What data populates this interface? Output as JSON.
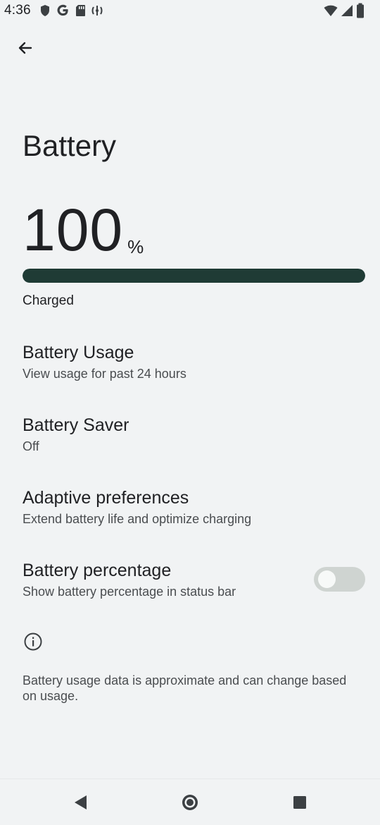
{
  "status_bar": {
    "time": "4:36",
    "left_icons": [
      "shield-icon",
      "google-icon",
      "sd-card-icon",
      "signal-sync-icon"
    ],
    "right_icons": [
      "wifi-icon",
      "cellular-icon",
      "battery-icon"
    ]
  },
  "app_bar": {
    "back_icon": "arrow-back-icon"
  },
  "page": {
    "title": "Battery"
  },
  "battery": {
    "level_value": "100",
    "level_unit": "%",
    "level_fraction": 1.0,
    "status": "Charged",
    "bar_color": "#1f3b35"
  },
  "preferences": [
    {
      "title": "Battery Usage",
      "summary": "View usage for past 24 hours"
    },
    {
      "title": "Battery Saver",
      "summary": "Off"
    },
    {
      "title": "Adaptive preferences",
      "summary": "Extend battery life and optimize charging"
    },
    {
      "title": "Battery percentage",
      "summary": "Show battery percentage in status bar",
      "toggle_on": false
    }
  ],
  "footer": {
    "icon": "info-icon",
    "text": "Battery usage data is approximate and can change based on usage."
  },
  "nav_bar": {
    "buttons": [
      "nav-back-icon",
      "nav-home-icon",
      "nav-recents-icon"
    ]
  }
}
